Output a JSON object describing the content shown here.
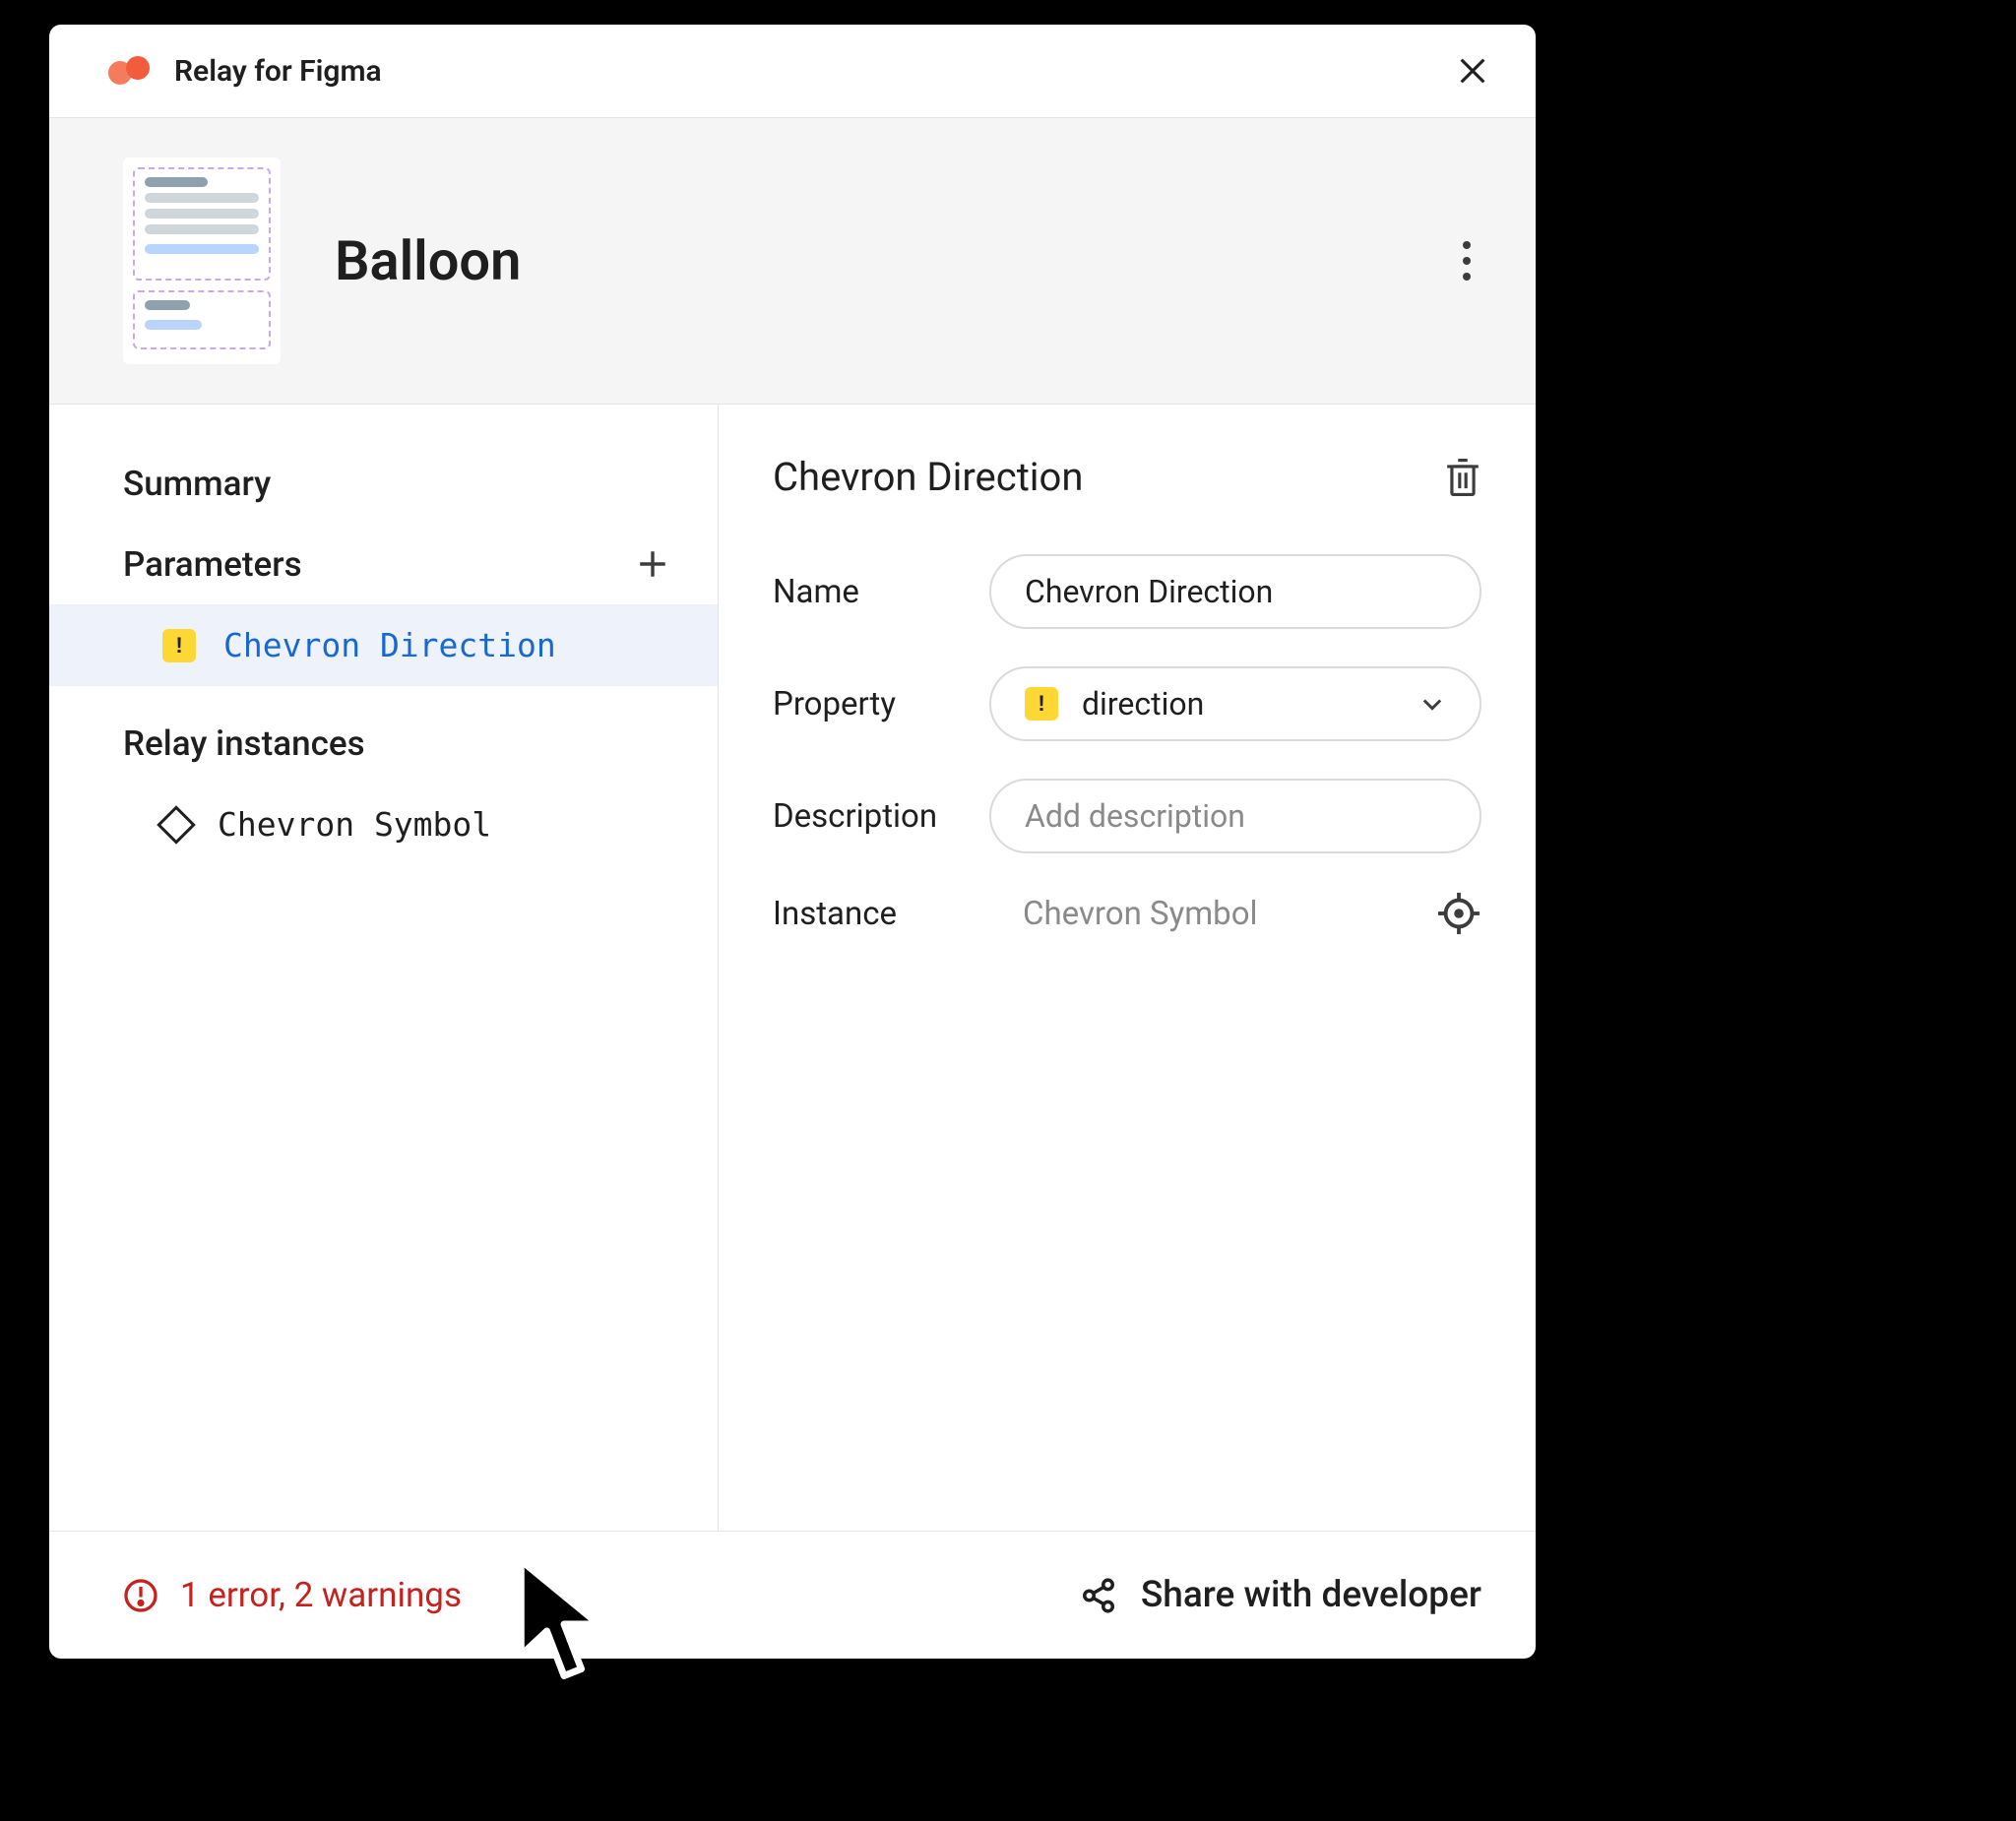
{
  "title": "Relay for Figma",
  "component": {
    "name": "Balloon"
  },
  "sidebar": {
    "summary_label": "Summary",
    "parameters_label": "Parameters",
    "instances_label": "Relay instances",
    "param_items": [
      {
        "label": "Chevron Direction",
        "has_warning": true,
        "selected": true
      }
    ],
    "instance_items": [
      {
        "label": "Chevron Symbol"
      }
    ]
  },
  "detail": {
    "title": "Chevron Direction",
    "fields": {
      "name": {
        "label": "Name",
        "value": "Chevron Direction"
      },
      "property": {
        "label": "Property",
        "value": "direction",
        "has_warning": true
      },
      "description": {
        "label": "Description",
        "placeholder": "Add description"
      },
      "instance": {
        "label": "Instance",
        "value": "Chevron Symbol"
      }
    }
  },
  "footer": {
    "errors_text": "1 error, 2 warnings",
    "share_label": "Share with developer"
  },
  "icons": {
    "warn_glyph": "!"
  }
}
